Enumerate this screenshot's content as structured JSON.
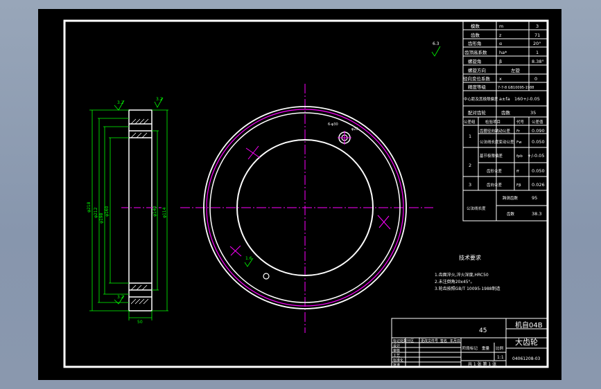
{
  "colors": {
    "frame": "#ffffff",
    "centerline": "#ff00ff",
    "dimension": "#00ff00",
    "text": "#ffffff",
    "bore_circle": "#ff00ff"
  },
  "parameter_table": {
    "rows": [
      {
        "name": "模数",
        "symbol": "m",
        "value": "3"
      },
      {
        "name": "齿数",
        "symbol": "z",
        "value": "71"
      },
      {
        "name": "齿形角",
        "symbol": "α",
        "value": "20°"
      },
      {
        "name": "齿顶高系数",
        "symbol": "ha*",
        "value": "1"
      },
      {
        "name": "螺旋角",
        "symbol": "β",
        "value": "8.38°"
      },
      {
        "name": "螺旋方向",
        "symbol": "",
        "value": "左旋"
      },
      {
        "name": "径向变位系数",
        "symbol": "x",
        "value": "0"
      },
      {
        "name": "精度等级",
        "symbol": "",
        "value": "7-7-8 GB10095-1988"
      },
      {
        "name": "中心距及其极限偏差",
        "symbol": "a±fa",
        "value": "160+/-0.05"
      },
      {
        "name": "配对齿轮",
        "symbol": "齿数",
        "value": "35"
      }
    ],
    "inspect_header": [
      "公差组",
      "检验项目",
      "代号",
      "公差值"
    ],
    "inspect_rows": [
      {
        "group": "1",
        "item": "齿圈径向跳动公差",
        "code": "Fr",
        "value": "0.090"
      },
      {
        "group": "",
        "item": "公法线长度变动公差",
        "code": "Fw",
        "value": "0.050"
      },
      {
        "group": "2",
        "item": "基节极限偏差",
        "code": "fpb",
        "value": "+/-0.05"
      },
      {
        "group": "",
        "item": "齿形公差",
        "code": "ff",
        "value": "0.050"
      },
      {
        "group": "3",
        "item": "齿向公差",
        "code": "Fβ",
        "value": "0.026"
      }
    ],
    "span_rows": [
      {
        "name": "公法线长度",
        "sub": "跨测齿数",
        "value": "95"
      },
      {
        "name": "",
        "sub": "齿数",
        "value": "38.3"
      }
    ]
  },
  "tech_requirements": {
    "title": "技术要求",
    "items": [
      "1.齿面淬火,淬火深度,HRC50",
      "2.未注倒角20x45°。",
      "3.轮齿按照GB/T 10095-1988制造"
    ]
  },
  "title_block": {
    "material": "45",
    "school": "机自04B",
    "part_name": "大齿轮",
    "drawing_no": "04061208-03",
    "scale_label": "比例",
    "scale": "1:1",
    "sheet": "共 1 张 第 1 张",
    "headers": [
      "标记",
      "处数",
      "分区",
      "更改文件号",
      "签名",
      "年月日"
    ],
    "roles": [
      "设计",
      "审核",
      "工艺",
      "标准化",
      "批准"
    ],
    "stage_labels": [
      "阶段标记",
      "重量",
      "比例"
    ]
  },
  "dimensions": {
    "left_labels": [
      "φ218",
      "φ212",
      "φ198",
      "φ160",
      "φ140",
      "φ114"
    ],
    "width": "50",
    "roughness_labels": [
      "3.2",
      "3.2",
      "3.2",
      "6.3",
      "1.6"
    ],
    "hole_labels": [
      "6-φ30",
      "φ20"
    ]
  }
}
